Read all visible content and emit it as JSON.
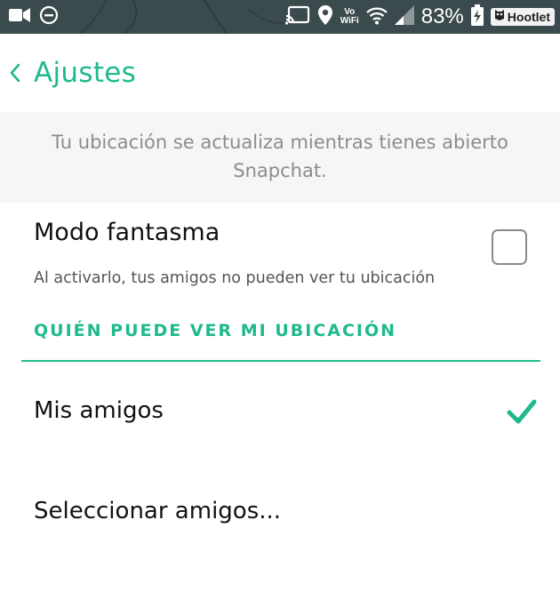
{
  "status_bar": {
    "battery_percent": "83%",
    "vowifi_top": "Vo",
    "vowifi_bottom": "WiFi",
    "hootlet_label": "Hootlet",
    "icons_left": [
      "video-camera-icon",
      "do-not-disturb-icon"
    ],
    "icons_right": [
      "cast-icon",
      "location-pin-icon",
      "wifi-icon",
      "signal-icon",
      "battery-charging-icon"
    ]
  },
  "header": {
    "back_icon": "chevron-left-icon",
    "title": "Ajustes"
  },
  "info": {
    "text": "Tu ubicación se actualiza mientras tienes abierto Snapchat."
  },
  "ghost_mode": {
    "title": "Modo fantasma",
    "subtitle": "Al activarlo, tus amigos no pueden ver tu ubicación",
    "checked": false
  },
  "visibility": {
    "section_title": "QUIÉN PUEDE VER MI UBICACIÓN",
    "options": [
      {
        "label": "Mis amigos",
        "selected": true
      },
      {
        "label": "Seleccionar amigos...",
        "selected": false
      }
    ]
  },
  "colors": {
    "accent": "#1fb98e",
    "status_bar_bg": "#3b4a4c",
    "banner_bg": "#f6f6f6"
  }
}
